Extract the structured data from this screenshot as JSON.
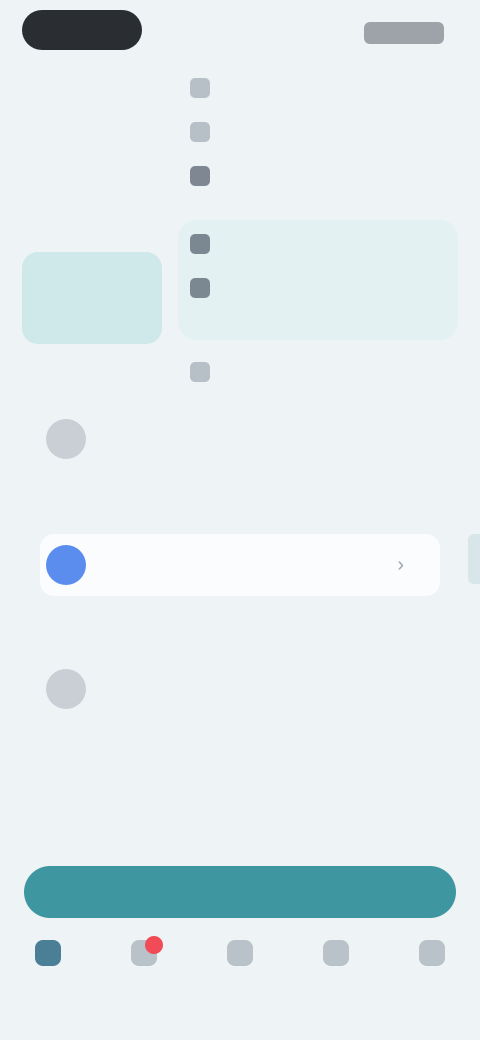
{
  "status_bar": {
    "time": "",
    "indicators": ""
  },
  "menu": {
    "items": [
      {
        "label": "",
        "icon": "clock-icon"
      },
      {
        "label": "",
        "icon": "refresh-icon"
      },
      {
        "label": "",
        "icon": "list-icon"
      },
      {
        "label": "",
        "icon": "grid-icon"
      },
      {
        "label": "",
        "icon": "document-icon"
      },
      {
        "label": "",
        "icon": "plus-icon"
      }
    ]
  },
  "left_panel": {
    "line1": "",
    "line2": ""
  },
  "list": {
    "rows": [
      {
        "title": "",
        "subtitle": "",
        "icon": "avatar"
      },
      {
        "title": "",
        "subtitle": "",
        "icon": "avatar",
        "selected": true
      },
      {
        "title": "",
        "subtitle": "",
        "icon": "avatar"
      }
    ],
    "footer_text": ""
  },
  "cta": {
    "label": ""
  },
  "tabs": [
    {
      "label": "",
      "icon": "home-icon",
      "active": true
    },
    {
      "label": "",
      "icon": "bell-icon",
      "badge": true
    },
    {
      "label": "",
      "icon": "chat-icon"
    },
    {
      "label": "",
      "icon": "search-icon"
    },
    {
      "label": "",
      "icon": "profile-icon"
    }
  ],
  "colors": {
    "background": "#eef3f6",
    "cta": "#3e96a0",
    "accent_blue": "#5b8def",
    "badge_red": "#f04b57",
    "hero_teal": "#cfe8ea"
  }
}
